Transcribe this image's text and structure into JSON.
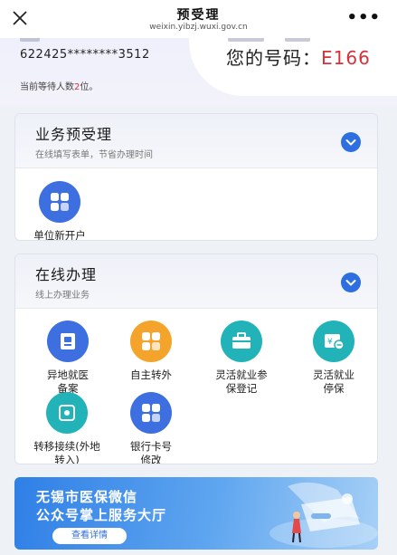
{
  "nav": {
    "title": "预受理",
    "url": "weixin.yibzj.wuxi.gov.cn"
  },
  "queue": {
    "id_number": "622425********3512",
    "your_number_label": "您的号码：",
    "your_number": "E166",
    "waiting_prefix": "当前等待人数",
    "waiting_count": "2",
    "waiting_suffix": "位。"
  },
  "pre_accept": {
    "title": "业务预受理",
    "subtitle": "在线填写表单，节省办理时间",
    "items": [
      {
        "label": "单位新开户",
        "icon": "grid-icon",
        "color": "#3d6fe0"
      }
    ]
  },
  "online": {
    "title": "在线办理",
    "subtitle": "线上办理业务",
    "items": [
      {
        "label": "异地就医备案",
        "icon": "card-icon",
        "color": "#3d6fe0"
      },
      {
        "label": "自主转外",
        "icon": "grid-icon",
        "color": "#f4a42a"
      },
      {
        "label": "灵活就业参保登记",
        "icon": "briefcase-icon",
        "color": "#22b3b8"
      },
      {
        "label": "灵活就业停保",
        "icon": "stop-insurance-icon",
        "color": "#22b3b8"
      },
      {
        "label": "转移接续(外地转入)",
        "icon": "transfer-icon",
        "color": "#22b3b8"
      },
      {
        "label": "银行卡号修改",
        "icon": "grid-icon",
        "color": "#3d6fe0"
      }
    ]
  },
  "banner": {
    "line1": "无锡市医保微信",
    "line2": "公众号掌上服务大厅",
    "button": "查看详情"
  },
  "colors": {
    "accent": "#2d6fe0",
    "highlight": "#d6323a"
  }
}
